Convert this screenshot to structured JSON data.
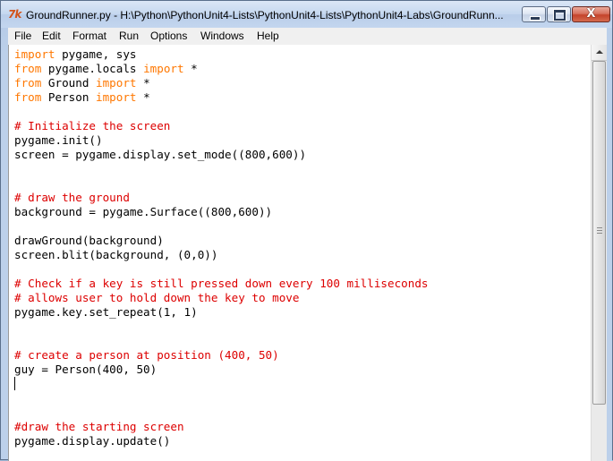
{
  "window": {
    "title": "GroundRunner.py - H:\\Python\\PythonUnit4-Lists\\PythonUnit4-Lists\\PythonUnit4-Labs\\GroundRunn...",
    "icon": "idle-python-icon",
    "icon_glyph": "7k",
    "controls": {
      "minimize": "minimize-icon",
      "maximize": "maximize-icon",
      "close": "close-icon",
      "close_glyph": "X"
    }
  },
  "menu": {
    "items": [
      "File",
      "Edit",
      "Format",
      "Run",
      "Options",
      "Windows",
      "Help"
    ]
  },
  "editor": {
    "colors": {
      "keyword": "#ff7700",
      "comment": "#dd0000",
      "text": "#000000"
    },
    "lines": [
      [
        {
          "k": "kw",
          "t": "import"
        },
        {
          "k": "tx",
          "t": " pygame, sys"
        }
      ],
      [
        {
          "k": "kw",
          "t": "from"
        },
        {
          "k": "tx",
          "t": " pygame.locals "
        },
        {
          "k": "kw",
          "t": "import"
        },
        {
          "k": "tx",
          "t": " *"
        }
      ],
      [
        {
          "k": "kw",
          "t": "from"
        },
        {
          "k": "tx",
          "t": " Ground "
        },
        {
          "k": "kw",
          "t": "import"
        },
        {
          "k": "tx",
          "t": " *"
        }
      ],
      [
        {
          "k": "kw",
          "t": "from"
        },
        {
          "k": "tx",
          "t": " Person "
        },
        {
          "k": "kw",
          "t": "import"
        },
        {
          "k": "tx",
          "t": " *"
        }
      ],
      [],
      [
        {
          "k": "cm",
          "t": "# Initialize the screen"
        }
      ],
      [
        {
          "k": "tx",
          "t": "pygame.init()"
        }
      ],
      [
        {
          "k": "tx",
          "t": "screen = pygame.display.set_mode((800,600))"
        }
      ],
      [],
      [],
      [
        {
          "k": "cm",
          "t": "# draw the ground"
        }
      ],
      [
        {
          "k": "tx",
          "t": "background = pygame.Surface((800,600))"
        }
      ],
      [],
      [
        {
          "k": "tx",
          "t": "drawGround(background)"
        }
      ],
      [
        {
          "k": "tx",
          "t": "screen.blit(background, (0,0))"
        }
      ],
      [],
      [
        {
          "k": "cm",
          "t": "# Check if a key is still pressed down every 100 milliseconds"
        }
      ],
      [
        {
          "k": "cm",
          "t": "# allows user to hold down the key to move"
        }
      ],
      [
        {
          "k": "tx",
          "t": "pygame.key.set_repeat(1, 1)"
        }
      ],
      [],
      [],
      [
        {
          "k": "cm",
          "t": "# create a person at position (400, 50)"
        }
      ],
      [
        {
          "k": "tx",
          "t": "guy = Person(400, 50)"
        }
      ],
      [],
      [],
      [],
      [
        {
          "k": "cm",
          "t": "#draw the starting screen"
        }
      ],
      [
        {
          "k": "tx",
          "t": "pygame.display.update()"
        }
      ]
    ]
  },
  "scrollbar": {
    "up_arrow": "scroll-up-arrow-icon"
  }
}
